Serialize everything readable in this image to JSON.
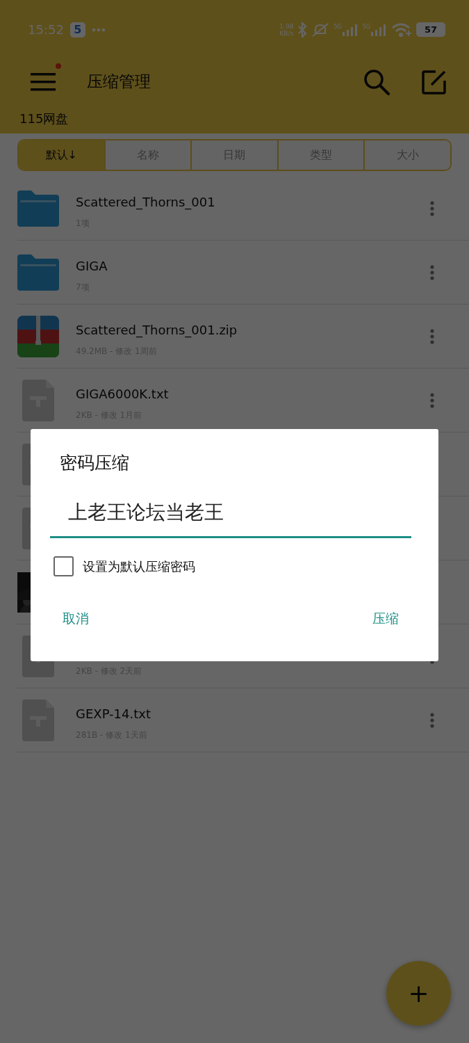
{
  "status_bar": {
    "time": "15:52",
    "app_badge": "5",
    "net_speed": "1.98",
    "net_unit": "KB/s",
    "net_type_1": "5G",
    "net_type_2": "5G",
    "battery": "57"
  },
  "app_bar": {
    "title": "压缩管理",
    "notification": true
  },
  "location": "115网盘",
  "sort_tabs": [
    {
      "label": "默认↓",
      "selected": true
    },
    {
      "label": "名称",
      "selected": false
    },
    {
      "label": "日期",
      "selected": false
    },
    {
      "label": "类型",
      "selected": false
    },
    {
      "label": "大小",
      "selected": false
    }
  ],
  "files": [
    {
      "kind": "folder",
      "name": "Scattered_Thorns_001",
      "meta": "1项"
    },
    {
      "kind": "folder",
      "name": "GIGA",
      "meta": "7项"
    },
    {
      "kind": "zip",
      "name": "Scattered_Thorns_001.zip",
      "meta": "49.2MB - 修改 1周前"
    },
    {
      "kind": "txt",
      "name": "GIGA6000K.txt",
      "meta": "2KB - 修改 1月前"
    },
    {
      "kind": "txt"
    },
    {
      "kind": "txt"
    },
    {
      "kind": "picture"
    },
    {
      "kind": "txt",
      "meta": "2KB - 修改 2天前"
    },
    {
      "kind": "txt",
      "name": "GEXP-14.txt",
      "meta": "281B - 修改 1天前"
    }
  ],
  "dialog": {
    "title": "密码压缩",
    "value": "上老王论坛当老王",
    "checkbox": {
      "label": "设置为默认压缩密码",
      "checked": false
    },
    "buttons": [
      "取消",
      "压缩"
    ]
  },
  "fab": {
    "label": "+"
  }
}
